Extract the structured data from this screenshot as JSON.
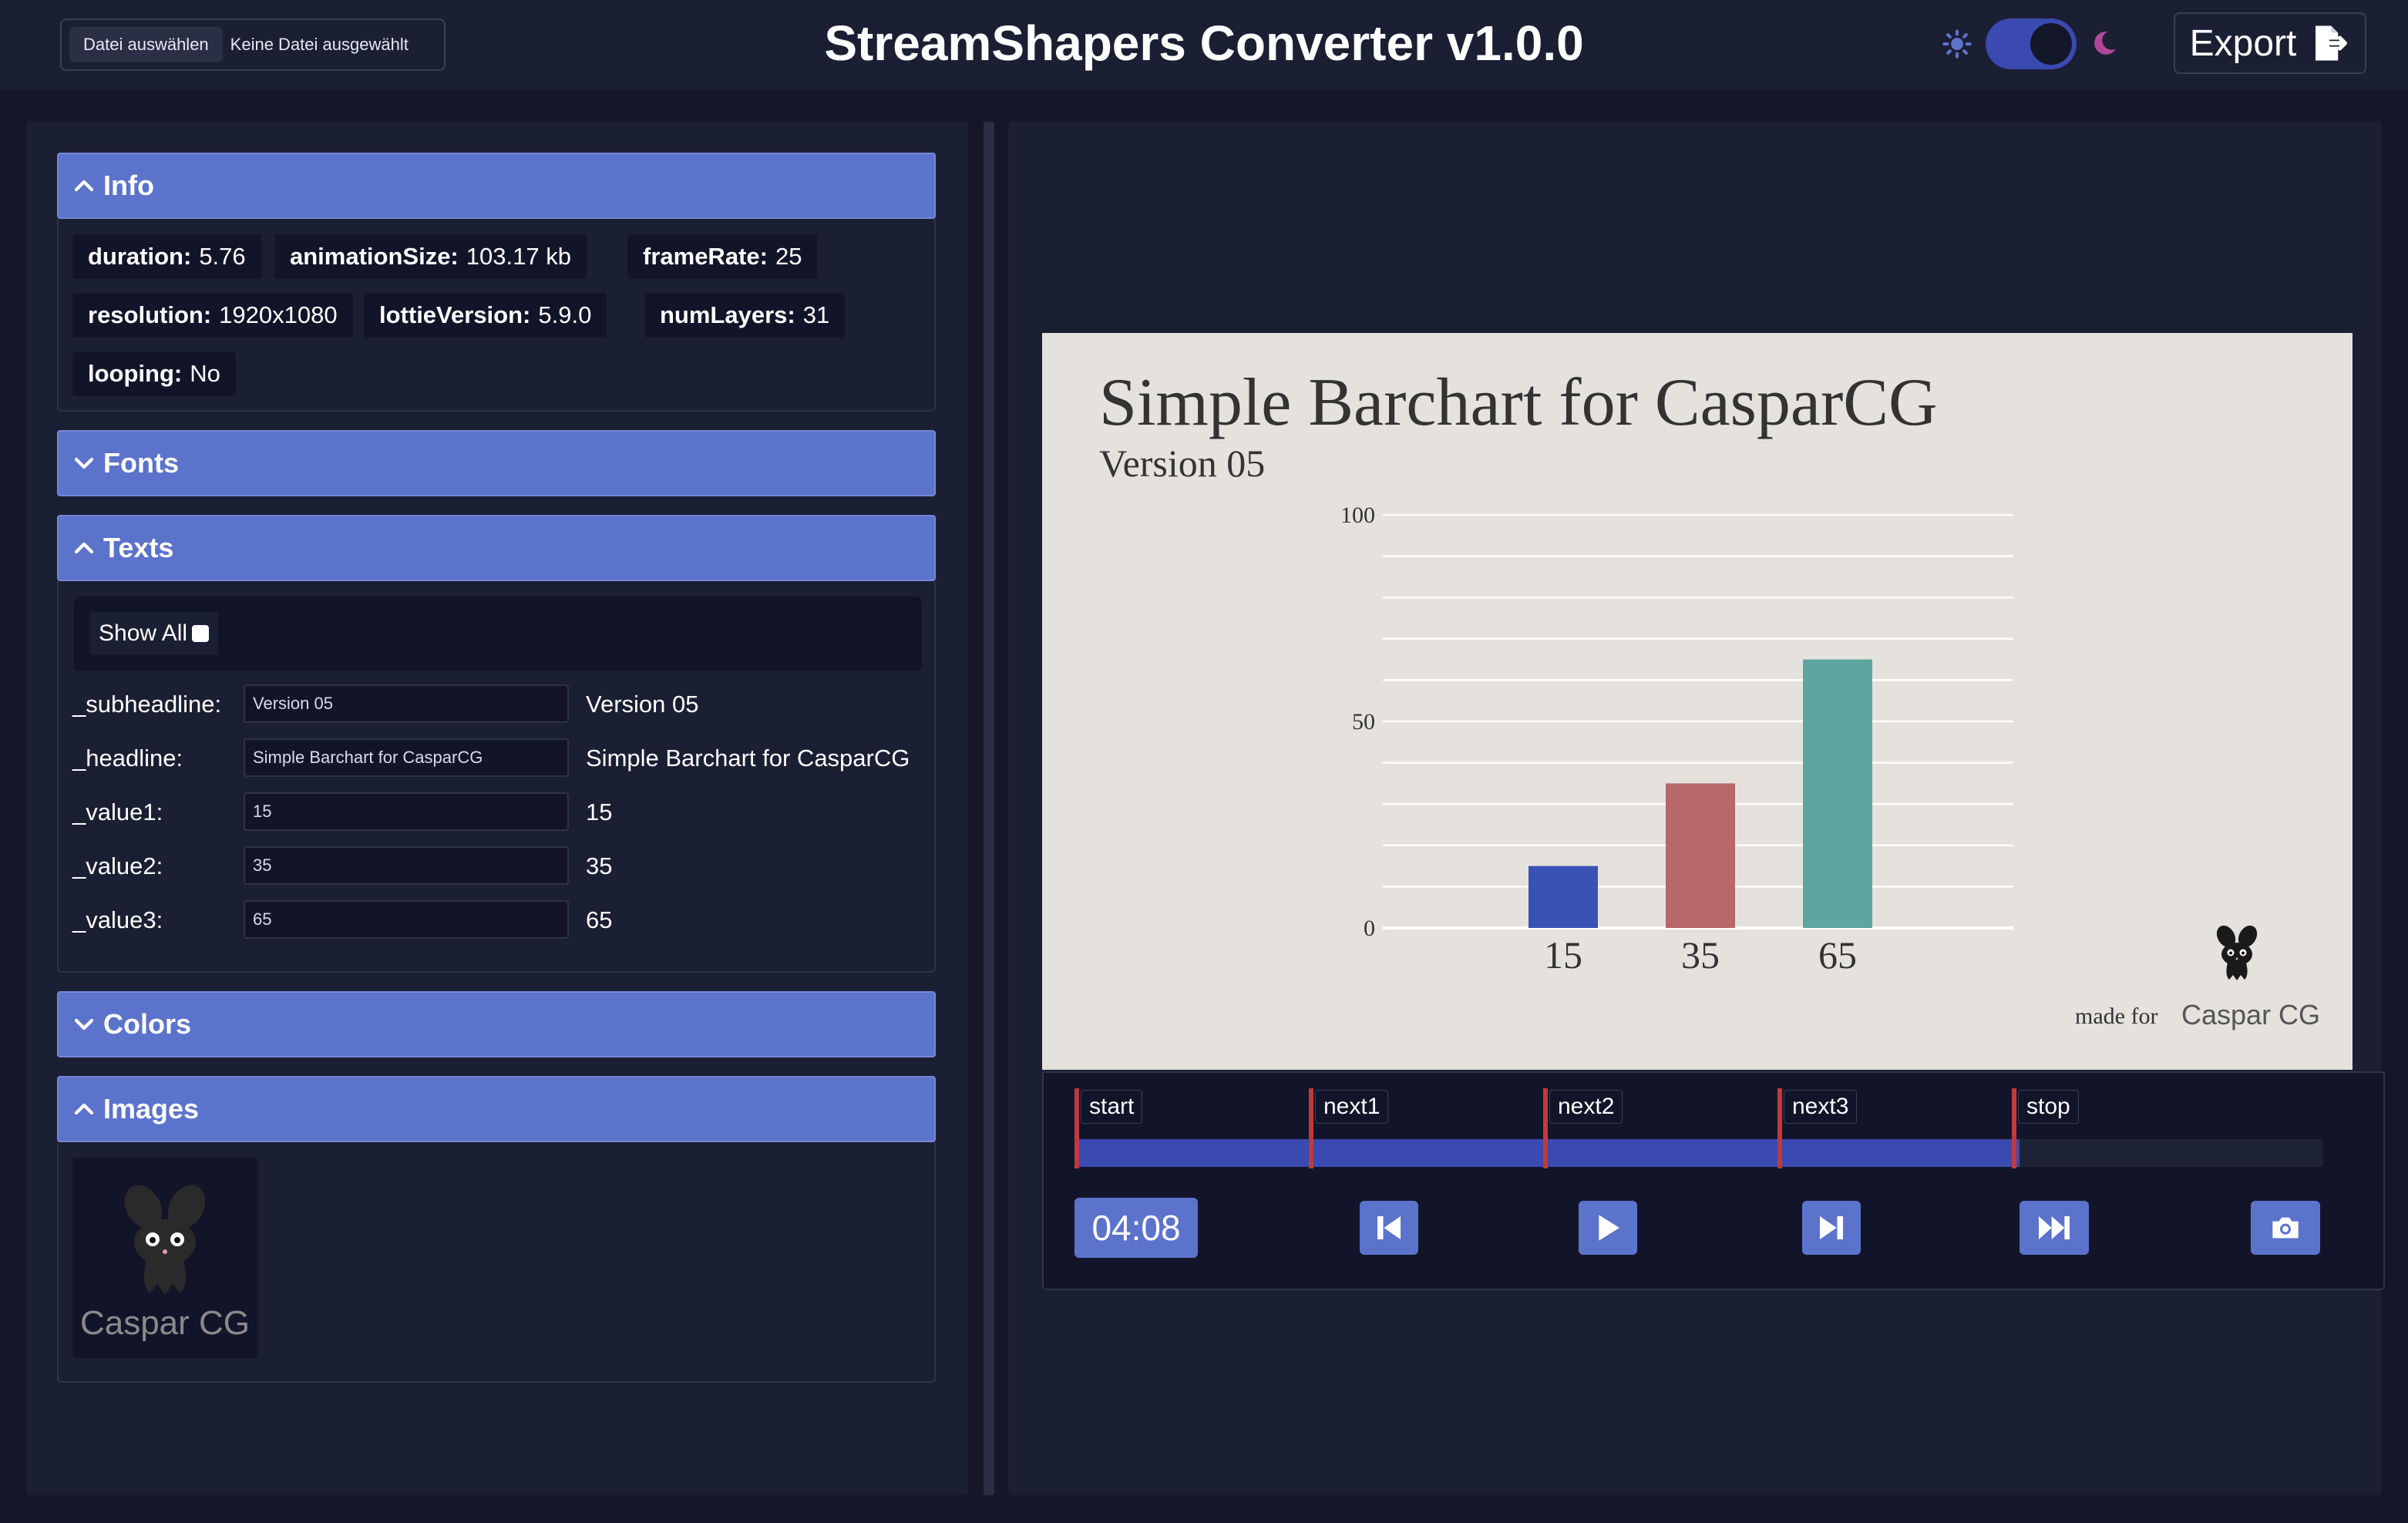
{
  "header": {
    "file_button": "Datei auswählen",
    "file_status": "Keine Datei ausgewählt",
    "title": "StreamShapers Converter v1.0.0",
    "theme_dark_enabled": true,
    "export_label": "Export"
  },
  "sections": {
    "info": {
      "title": "Info",
      "expanded": true,
      "items": [
        {
          "key": "duration:",
          "value": "5.76"
        },
        {
          "key": "animationSize:",
          "value": "103.17 kb"
        },
        {
          "key": "frameRate:",
          "value": "25"
        },
        {
          "key": "resolution:",
          "value": "1920x1080"
        },
        {
          "key": "lottieVersion:",
          "value": "5.9.0"
        },
        {
          "key": "numLayers:",
          "value": "31"
        },
        {
          "key": "looping:",
          "value": "No"
        }
      ]
    },
    "fonts": {
      "title": "Fonts",
      "expanded": false
    },
    "texts": {
      "title": "Texts",
      "expanded": true,
      "show_all_label": "Show All",
      "rows": [
        {
          "label": "_subheadline:",
          "input": "Version 05",
          "value": "Version 05"
        },
        {
          "label": "_headline:",
          "input": "Simple Barchart for CasparCG",
          "value": "Simple Barchart for CasparCG"
        },
        {
          "label": "_value1:",
          "input": "15",
          "value": "15"
        },
        {
          "label": "_value2:",
          "input": "35",
          "value": "35"
        },
        {
          "label": "_value3:",
          "input": "65",
          "value": "65"
        }
      ]
    },
    "colors": {
      "title": "Colors",
      "expanded": false
    },
    "images": {
      "title": "Images",
      "expanded": true,
      "thumb_caption": "Caspar CG"
    }
  },
  "preview": {
    "headline": "Simple Barchart for CasparCG",
    "subheadline": "Version 05",
    "made_for": "made for",
    "brand": "Caspar CG"
  },
  "chart_data": {
    "type": "bar",
    "categories": [
      "15",
      "35",
      "65"
    ],
    "values": [
      15,
      35,
      65
    ],
    "colors": [
      "#3a52b4",
      "#b8676b",
      "#5fa59f"
    ],
    "ylim": [
      0,
      100
    ],
    "yticks": [
      0,
      50,
      100
    ],
    "grid": true
  },
  "timeline": {
    "markers": [
      "start",
      "next1",
      "next2",
      "next3",
      "stop"
    ],
    "progress": 0.757,
    "time": "04:08"
  },
  "controls": [
    "skip-back-icon",
    "play-icon",
    "step-forward-icon",
    "fast-forward-icon",
    "camera-icon"
  ],
  "theme": {
    "accent": "#5c73cc",
    "panel": "#1b1f33",
    "background": "#141728"
  }
}
